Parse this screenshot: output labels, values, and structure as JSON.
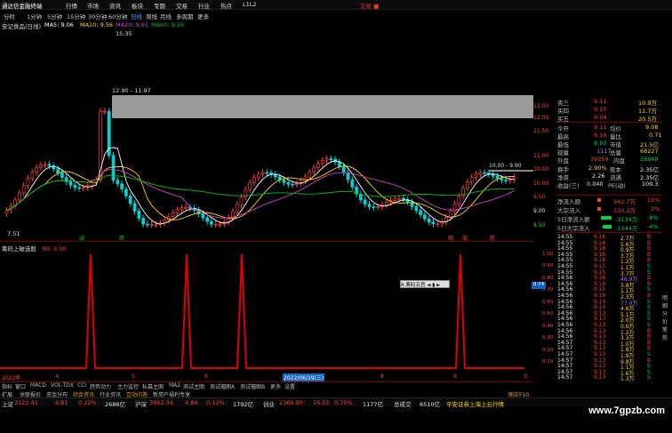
{
  "titlebar": {
    "app_title": "通达信金融终端",
    "menus": [
      "行情",
      "市场",
      "资讯",
      "板块",
      "专题",
      "交易",
      "行业",
      "热点",
      "L1L2"
    ],
    "right_label": "交易 ■"
  },
  "period_bar": {
    "items": [
      "分时",
      "1分钟",
      "5分钟",
      "15分钟",
      "30分钟",
      "60分钟",
      "日线",
      "周线",
      "月线",
      "多周期",
      "更多"
    ],
    "active": "日线"
  },
  "stock_line": {
    "name": "安记食品(日线)",
    "ma5": "MA5: 9.06",
    "ma10": "MA10: 9.56",
    "ma20": "MA20: 9.61",
    "ma60": "MA60: 9.26"
  },
  "colors": {
    "up": "#ff3b3b",
    "down": "#00d3d3",
    "ma5": "#ffffff",
    "ma10": "#ffd700",
    "ma20": "#d040d0",
    "ma60": "#00c000",
    "signal": "#e00000"
  },
  "main_chart": {
    "price_axis": [
      "12.50",
      "12.00",
      "11.50",
      "11.00",
      "10.50",
      "10.00",
      "9.50",
      "9.00",
      "8.50"
    ],
    "annotation_high": "15.35",
    "annotation_low": "7.51",
    "band_label": "12.90 - 11.97",
    "band_label_right": "10.00 - 9.90",
    "marker_labels": [
      "减",
      "跌",
      "明",
      "涨",
      "跌"
    ]
  },
  "sub_chart": {
    "title": "筹码上破选股",
    "value": "R0: 0.00",
    "axis": [
      "1.00",
      "0.90",
      "0.80",
      "0.70",
      "0.60",
      "0.50",
      "0.40",
      "0.30",
      "0.20",
      "0.10"
    ],
    "axis_current": "0.74",
    "float_box": "A 筹码五宫 ◄ ▮ ►"
  },
  "time_axis": {
    "labels": [
      "2022年",
      "4",
      "5",
      "6",
      "2022/06/29(三)",
      "8",
      "9",
      "E"
    ]
  },
  "order_book": {
    "rows": [
      {
        "label": "卖三",
        "price": "9.11",
        "vol": "10.9万"
      },
      {
        "label": "买四",
        "price": "9.10",
        "vol": "11.7万"
      },
      {
        "label": "买五",
        "price": "9.09",
        "vol": "20.5万"
      }
    ]
  },
  "quote": {
    "rows": [
      {
        "l1": "今开",
        "v1": "9.11",
        "l2": "均价",
        "v2": "9.08"
      },
      {
        "l1": "最高",
        "v1": "9.16",
        "l2": "量比",
        "v2": "0.71"
      },
      {
        "l1": "最低",
        "v1": "8.93",
        "l2": "市值",
        "v2": "21.5亿"
      },
      {
        "l1": "现量",
        "v1": "1117",
        "l2": "总量",
        "v2": "68227"
      },
      {
        "l1": "外盘",
        "v1": "39259",
        "l2": "内盘",
        "v2": "28968"
      },
      {
        "l1": "换手",
        "v1": "2.90%",
        "l2": "股本",
        "v2": "2.35亿"
      },
      {
        "l1": "净资",
        "v1": "2.26",
        "l2": "流通",
        "v2": "2.35亿"
      },
      {
        "l1": "收益(三)",
        "v1": "0.040",
        "l2": "PE(动)",
        "v2": "109.3"
      }
    ]
  },
  "flows": [
    {
      "label": "净流入额",
      "value": "942.7万",
      "pct": "15%"
    },
    {
      "label": "大宗流入",
      "value": "130.3万",
      "pct": "2%"
    },
    {
      "label": "5日净流入额",
      "value": "-3134万",
      "pct": "-8%"
    },
    {
      "label": "5日大宗流入",
      "value": "-1344万",
      "pct": "-4%"
    }
  ],
  "ticks": [
    {
      "t": "14:55",
      "p": "9.16",
      "v": "2.7万",
      "d": "B"
    },
    {
      "t": "14:55",
      "p": "9.16",
      "v": "5.6万",
      "d": "B"
    },
    {
      "t": "14:55",
      "p": "9.16",
      "v": "0.9万",
      "d": "B"
    },
    {
      "t": "14:55",
      "p": "9.16",
      "v": "3.7万",
      "d": "B"
    },
    {
      "t": "14:55",
      "p": "9.16",
      "v": "1.2万",
      "d": "B"
    },
    {
      "t": "14:55",
      "p": "9.15",
      "v": "1.1万",
      "d": "S"
    },
    {
      "t": "14:55",
      "p": "9.15",
      "v": "3.7万",
      "d": "S"
    },
    {
      "t": "14:56",
      "p": "9.16",
      "v": "46.9万",
      "d": "B"
    },
    {
      "t": "14:56",
      "p": "9.16",
      "v": "3.8万",
      "d": "B"
    },
    {
      "t": "14:56",
      "p": "9.15",
      "v": "1.1万",
      "d": "S"
    },
    {
      "t": "14:56",
      "p": "9.16",
      "v": "2.3万",
      "d": "B"
    },
    {
      "t": "14:56",
      "p": "9.14",
      "v": "77.0万",
      "d": "S"
    },
    {
      "t": "14:56",
      "p": "9.14",
      "v": "4.6万",
      "d": "S"
    },
    {
      "t": "14:56",
      "p": "9.13",
      "v": "5.1万",
      "d": "S"
    },
    {
      "t": "14:56",
      "p": "9.13",
      "v": "2.0万",
      "d": "S"
    },
    {
      "t": "14:56",
      "p": "9.13",
      "v": "0.6万",
      "d": "S"
    },
    {
      "t": "14:56",
      "p": "9.13",
      "v": "1.2万",
      "d": "B"
    },
    {
      "t": "14:56",
      "p": "9.13",
      "v": "3.3万",
      "d": "B"
    },
    {
      "t": "14:57",
      "p": "9.13",
      "v": "1.0万",
      "d": "B"
    },
    {
      "t": "14:57",
      "p": "9.13",
      "v": "1.8万",
      "d": "B"
    },
    {
      "t": "14:57",
      "p": "9.13",
      "v": "1.9万",
      "d": "S"
    },
    {
      "t": "14:57",
      "p": "9.13",
      "v": "9.8万",
      "d": "B"
    },
    {
      "t": "14:57",
      "p": "9.13",
      "v": "1.1万",
      "d": "S"
    },
    {
      "t": "14:57",
      "p": "9.13",
      "v": "1.6万",
      "d": "S"
    },
    {
      "t": "14:57",
      "p": "9.13",
      "v": "1.3万",
      "d": "S"
    }
  ],
  "tabs_row1": [
    "指标",
    "窗口",
    "MACD",
    "VOL-TDX",
    "CCI",
    "趋势动力",
    "主力监控",
    "私募主图",
    "MA2",
    "测试主图",
    "测试幅图A",
    "测试幅图B",
    "更多",
    "设置"
  ],
  "tabs_row2": [
    "扩展",
    "关联报价",
    "资金分布",
    "综合资讯",
    "行业资讯",
    "互动问答",
    "新用户福利专享"
  ],
  "status": {
    "sh_label": "上证",
    "sh_value": "3122.41",
    "sh_chg": "6.81",
    "sh_pct": "0.22%",
    "sh_amt": "2686亿",
    "sz_label": "沪深",
    "sz_value": "3962.34",
    "sz_chg": "4.84",
    "sz_pct": "0.12%",
    "sz_amt": "1792亿",
    "cy_label": "创业",
    "cy_value": "2366.90",
    "cy_chg": "16.52",
    "cy_pct": "0.70%",
    "cy_amt": "1177亿",
    "total_label": "总成交",
    "total_value": "6510亿",
    "broker": "平安证券上海上云行情"
  },
  "watermark": "www.7gpzb.com",
  "tick_side_tabs": [
    "明",
    "细",
    "分",
    "价",
    "笔",
    "势"
  ],
  "bottom_right": "图文F10 "
}
